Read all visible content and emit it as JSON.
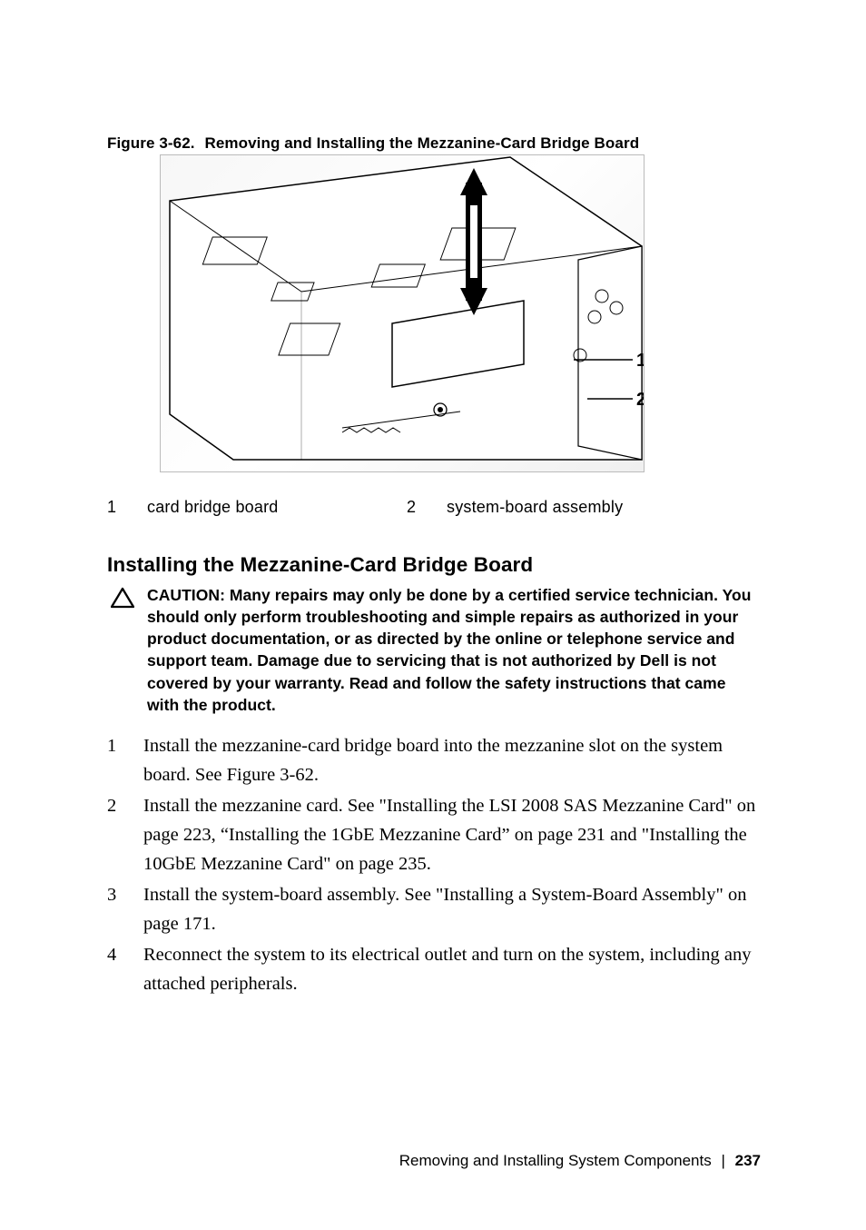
{
  "figure": {
    "number": "Figure 3-62.",
    "title": "Removing and Installing the Mezzanine-Card Bridge Board",
    "callouts": {
      "c1": "1",
      "c2": "2"
    }
  },
  "legend": {
    "num1": "1",
    "label1": "card bridge board",
    "num2": "2",
    "label2": "system-board assembly"
  },
  "section_heading": "Installing the Mezzanine-Card Bridge Board",
  "caution": "CAUTION: Many repairs may only be done by a certified service technician. You should only perform troubleshooting and simple repairs as authorized in your product documentation, or as directed by the online or telephone service and support team. Damage due to servicing that is not authorized by Dell is not covered by your warranty. Read and follow the safety instructions that came with the product.",
  "steps": {
    "s1": "Install the mezzanine-card bridge board into the mezzanine slot on the system board. See Figure 3-62.",
    "s2": "Install the mezzanine card. See \"Installing the LSI 2008 SAS Mezzanine Card\" on page 223, “Installing the 1GbE Mezzanine Card” on page 231 and \"Installing the 10GbE Mezzanine Card\" on page 235.",
    "s3": "Install the system-board assembly. See \"Installing a System-Board Assembly\" on page 171.",
    "s4": "Reconnect the system to its electrical outlet and turn on the system, including any attached peripherals."
  },
  "footer": {
    "text": "Removing and Installing System Components",
    "divider": "|",
    "page": "237"
  }
}
